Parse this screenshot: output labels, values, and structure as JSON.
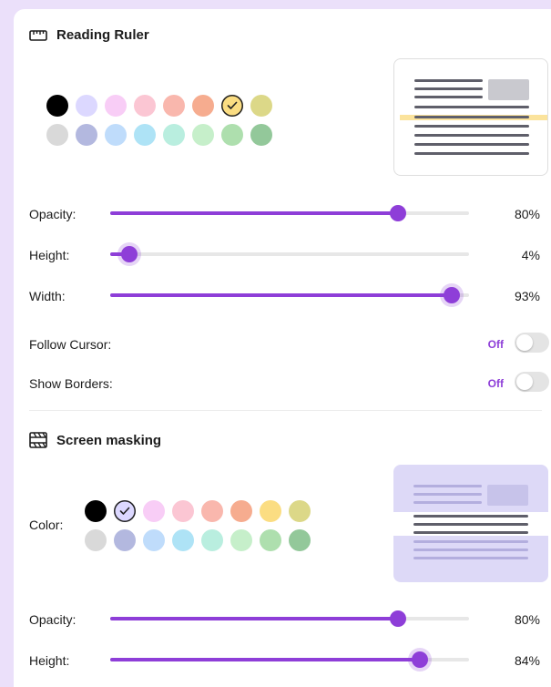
{
  "reading_ruler": {
    "title": "Reading Ruler",
    "icon": "ruler-icon",
    "swatches": {
      "row1": [
        "#000000",
        "#dcd8ff",
        "#f8cdf6",
        "#fbc6d3",
        "#f9b7ad",
        "#f6ac8f",
        "#fbdd82",
        "#dcd888"
      ],
      "row2": [
        "#d9d9d9",
        "#b3b8df",
        "#bfdcfb",
        "#aee3f6",
        "#b9eedf",
        "#c6efca",
        "#aedfae",
        "#93c89a"
      ],
      "selected": "#fbdd82"
    },
    "sliders": [
      {
        "label": "Opacity:",
        "value_text": "80%",
        "value": 0.78
      },
      {
        "label": "Height:",
        "value_text": "4%",
        "value": 0.03
      },
      {
        "label": "Width:",
        "value_text": "93%",
        "value": 0.93
      }
    ],
    "toggles": [
      {
        "label": "Follow Cursor:",
        "state": "Off"
      },
      {
        "label": "Show Borders:",
        "state": "Off"
      }
    ]
  },
  "screen_masking": {
    "title": "Screen masking",
    "icon": "film-icon",
    "color_label": "Color:",
    "swatches": {
      "row1": [
        "#000000",
        "#dcd8ff",
        "#f8cdf6",
        "#fbc6d3",
        "#f9b7ad",
        "#f6ac8f",
        "#fbdd82",
        "#dcd888"
      ],
      "row2": [
        "#d9d9d9",
        "#b3b8df",
        "#bfdcfb",
        "#aee3f6",
        "#b9eedf",
        "#c6efca",
        "#aedfae",
        "#93c89a"
      ],
      "selected": "#dcd8ff"
    },
    "sliders": [
      {
        "label": "Opacity:",
        "value_text": "80%",
        "value": 0.78
      },
      {
        "label": "Height:",
        "value_text": "84%",
        "value": 0.84
      }
    ]
  },
  "colors": {
    "accent": "#8e3ed8",
    "background": "#ebe0fa",
    "ruler_highlight": "#fbe39c",
    "mask_tint": "#ddd9f7"
  }
}
